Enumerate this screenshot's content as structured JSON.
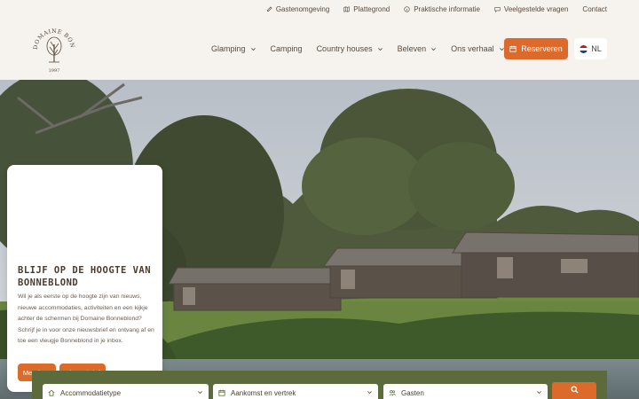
{
  "topbar": {
    "links": [
      {
        "label": "Gastenomgeving",
        "icon": "pencil-icon"
      },
      {
        "label": "Plattegrond",
        "icon": "map-icon"
      },
      {
        "label": "Praktische informatie",
        "icon": "info-icon"
      },
      {
        "label": "Veelgestelde vragen",
        "icon": "chat-icon"
      },
      {
        "label": "Contact",
        "icon": ""
      }
    ]
  },
  "logo": {
    "arc_text": "DOMAINE BONNEBLOND",
    "year": "1997"
  },
  "nav": [
    {
      "label": "Glamping",
      "dropdown": true
    },
    {
      "label": "Camping",
      "dropdown": false
    },
    {
      "label": "Country houses",
      "dropdown": true
    },
    {
      "label": "Beleven",
      "dropdown": true
    },
    {
      "label": "Ons verhaal",
      "dropdown": true
    }
  ],
  "header": {
    "reserve_label": "Reserveren",
    "lang_label": "NL"
  },
  "newsletter": {
    "title": "Blijf op de hoogte van Bonneblond",
    "text": "Wil je als eerste op de hoogte zijn van nieuws, nieuwe accommodaties, activiteiten en een kijkje achter de schermen bij Domaine Bonneblond? Schrijf je in voor onze nieuwsbrief en ontvang af en toe een vleugje Bonneblond in je inbox.",
    "join_label": "Meedoen",
    "newsletter_label": "Nieuwsbrief"
  },
  "booking": {
    "accommodation_placeholder": "Accommodatietype",
    "dates_placeholder": "Aankomst en vertrek",
    "guests_placeholder": "Gasten"
  },
  "colors": {
    "accent": "#dc6a2a",
    "olive": "#5c6a3c",
    "background": "#f6f3ee",
    "text": "#4a3d30"
  }
}
